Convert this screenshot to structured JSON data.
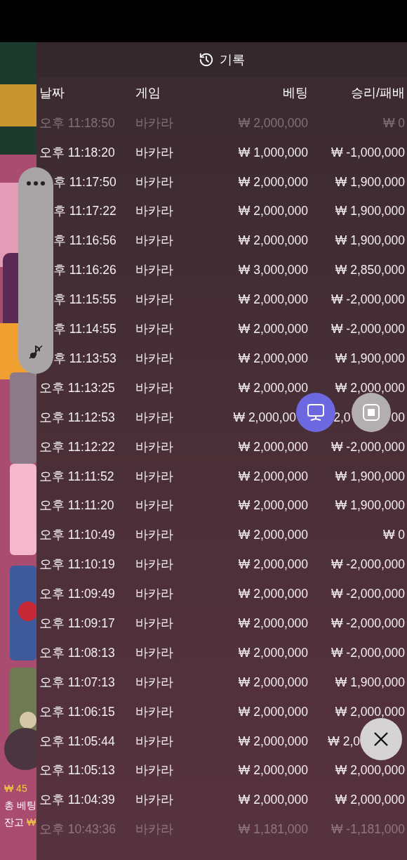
{
  "header": {
    "title": "기록"
  },
  "table": {
    "columns": [
      "날짜",
      "게임",
      "베팅",
      "승리/패배"
    ],
    "rows": [
      {
        "cells": [
          "오후 11:18:50",
          "바카라",
          "₩ 2,000,000",
          "₩ 0"
        ],
        "faded": true
      },
      {
        "cells": [
          "오후 11:18:20",
          "바카라",
          "₩ 1,000,000",
          "₩ -1,000,000"
        ],
        "faded": false
      },
      {
        "cells": [
          {
            "text": "후 11:17:50",
            "kind": "cut_left"
          },
          "바카라",
          "₩ 2,000,000",
          "₩ 1,900,000"
        ],
        "faded": false
      },
      {
        "cells": [
          {
            "text": "후 11:17:22",
            "kind": "cut_left"
          },
          "바카라",
          "₩ 2,000,000",
          "₩ 1,900,000"
        ],
        "faded": false
      },
      {
        "cells": [
          {
            "text": "후 11:16:56",
            "kind": "cut_left"
          },
          "바카라",
          "₩ 2,000,000",
          "₩ 1,900,000"
        ],
        "faded": false
      },
      {
        "cells": [
          {
            "text": "후 11:16:26",
            "kind": "cut_left"
          },
          "바카라",
          "₩ 3,000,000",
          "₩ 2,850,000"
        ],
        "faded": false
      },
      {
        "cells": [
          {
            "text": "후 11:15:55",
            "kind": "cut_left"
          },
          "바카라",
          "₩ 2,000,000",
          "₩ -2,000,000"
        ],
        "faded": false
      },
      {
        "cells": [
          {
            "text": "후 11:14:55",
            "kind": "cut_left"
          },
          "바카라",
          "₩ 2,000,000",
          "₩ -2,000,000"
        ],
        "faded": false
      },
      {
        "cells": [
          {
            "text": "후 11:13:53",
            "kind": "cut_left"
          },
          "바카라",
          "₩ 2,000,000",
          "₩ 1,900,000"
        ],
        "faded": false
      },
      {
        "cells": [
          "오후 11:13:25",
          "바카라",
          "₩ 2,000,000",
          "₩ 2,000,000"
        ],
        "faded": false
      },
      {
        "cells": [
          "오후 11:12:53",
          "바카라",
          {
            "text": "₩ 2,000,00",
            "kind": "cut_right"
          },
          {
            "parts": [
              "2,0",
              "00"
            ],
            "kind": "cut_middle"
          }
        ],
        "faded": false
      },
      {
        "cells": [
          "오후 11:12:22",
          "바카라",
          "₩ 2,000,000",
          "₩ -2,000,000"
        ],
        "faded": false
      },
      {
        "cells": [
          "오후 11:11:52",
          "바카라",
          "₩ 2,000,000",
          "₩ 1,900,000"
        ],
        "faded": false
      },
      {
        "cells": [
          "오후 11:11:20",
          "바카라",
          "₩ 2,000,000",
          "₩ 1,900,000"
        ],
        "faded": false
      },
      {
        "cells": [
          "오후 11:10:49",
          "바카라",
          "₩ 2,000,000",
          "₩ 0"
        ],
        "faded": false
      },
      {
        "cells": [
          "오후 11:10:19",
          "바카라",
          "₩ 2,000,000",
          "₩ -2,000,000"
        ],
        "faded": false
      },
      {
        "cells": [
          "오후 11:09:49",
          "바카라",
          "₩ 2,000,000",
          "₩ -2,000,000"
        ],
        "faded": false
      },
      {
        "cells": [
          "오후 11:09:17",
          "바카라",
          "₩ 2,000,000",
          "₩ -2,000,000"
        ],
        "faded": false
      },
      {
        "cells": [
          "오후 11:08:13",
          "바카라",
          "₩ 2,000,000",
          "₩ -2,000,000"
        ],
        "faded": false
      },
      {
        "cells": [
          "오후 11:07:13",
          "바카라",
          "₩ 2,000,000",
          "₩ 1,900,000"
        ],
        "faded": false
      },
      {
        "cells": [
          "오후 11:06:15",
          "바카라",
          "₩ 2,000,000",
          "₩ 2,000,000"
        ],
        "faded": false
      },
      {
        "cells": [
          "오후 11:05:44",
          "바카라",
          "₩ 2,000,000",
          {
            "text": "₩ 2,0",
            "kind": "cut_right"
          }
        ],
        "faded": false
      },
      {
        "cells": [
          "오후 11:05:13",
          "바카라",
          "₩ 2,000,000",
          "₩ 2,000,000"
        ],
        "faded": false
      },
      {
        "cells": [
          "오후 11:04:39",
          "바카라",
          "₩ 2,000,000",
          "₩ 2,000,000"
        ],
        "faded": false
      },
      {
        "cells": [
          "오후 10:43:36",
          "바카라",
          "₩ 1,181,000",
          "₩ -1,181,000"
        ],
        "faded": true
      }
    ]
  },
  "side_info": [
    {
      "label": "₩ 45",
      "kind": "amount"
    },
    {
      "label": "총 베팅",
      "kind": "text"
    },
    {
      "label": "잔고",
      "value": "₩",
      "kind": "text"
    }
  ]
}
